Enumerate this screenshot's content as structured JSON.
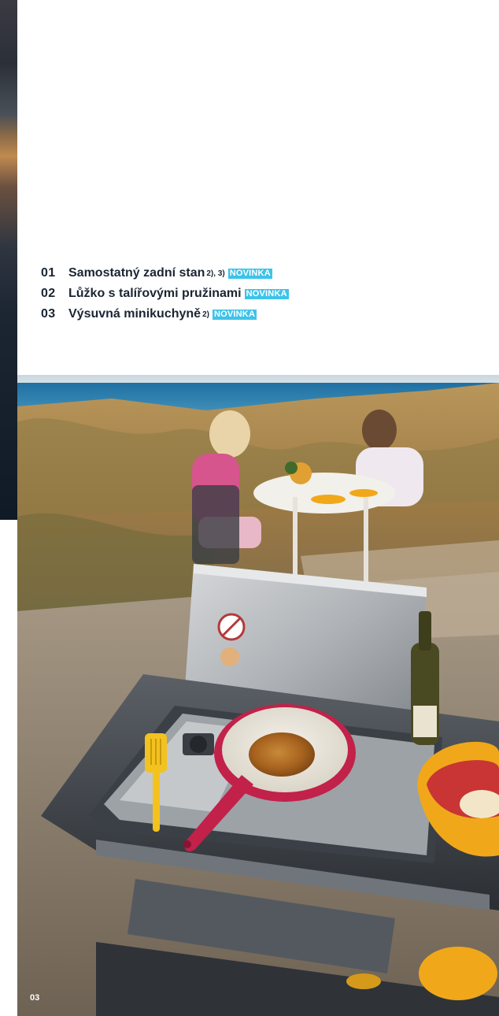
{
  "features": [
    {
      "number": "01",
      "title": "Samostatný zadní stan",
      "footnote": "2), 3)",
      "badge": "NOVINKA"
    },
    {
      "number": "02",
      "title": "Lůžko s talířovými pružinami",
      "footnote": "",
      "badge": "NOVINKA"
    },
    {
      "number": "03",
      "title": "Výsuvná minikuchyně",
      "footnote": "2)",
      "badge": "NOVINKA"
    }
  ],
  "page_number": "03",
  "colors": {
    "text": "#1b2533",
    "badge_background": "#3ec3ea",
    "badge_text": "#ffffff"
  },
  "photo": {
    "subject": "pull-out mini kitchen with frying pan and pancake, two women at a table in the dunes by the sea"
  }
}
